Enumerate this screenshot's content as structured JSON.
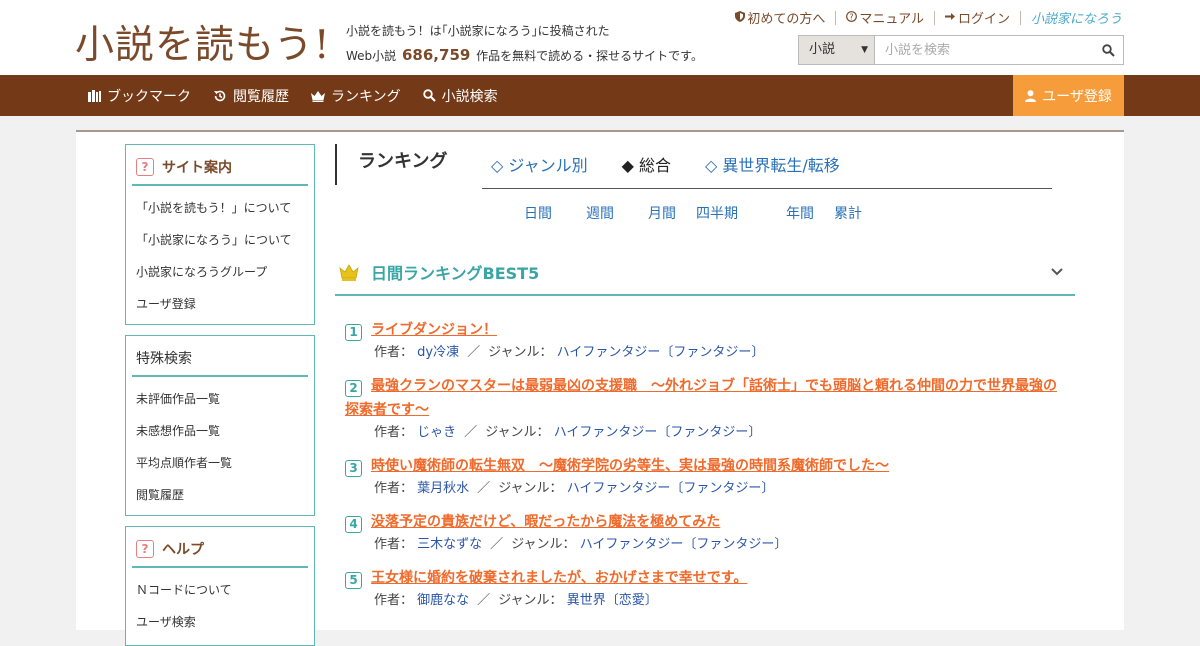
{
  "header": {
    "logo_text": "小説を読もう!",
    "tagline_line1": "小説を読もう！は｢小説家になろう｣に投稿された",
    "tagline_prefix": "Web小説",
    "work_count": "686,759",
    "tagline_suffix": "作品を無料で読める・探せるサイトです。",
    "links": {
      "beginners": "初めての方へ",
      "manual": "マニュアル",
      "login": "ログイン",
      "narou_logo": "小説家になろう"
    },
    "search": {
      "category": "小説",
      "placeholder": "小説を検索"
    }
  },
  "nav": {
    "bookmark": "ブックマーク",
    "history": "閲覧履歴",
    "ranking": "ランキング",
    "search": "小説検索",
    "register": "ユーザ登録"
  },
  "sidebar": {
    "site_guide": {
      "title": "サイト案内",
      "items": [
        "「小説を読もう！」について",
        "「小説家になろう」について",
        "小説家になろうグループ",
        "ユーザ登録"
      ]
    },
    "special_search": {
      "title": "特殊検索",
      "items": [
        "未評価作品一覧",
        "未感想作品一覧",
        "平均点順作者一覧",
        "閲覧履歴"
      ]
    },
    "help": {
      "title": "ヘルプ",
      "items": [
        "Ｎコードについて",
        "ユーザ検索"
      ]
    }
  },
  "ranking": {
    "title": "ランキング",
    "tabs": [
      "◇ ジャンル別",
      "◆ 総合",
      "◇ 異世界転生/転移"
    ],
    "active_tab": 1,
    "periods": [
      "日間",
      "週間",
      "月間",
      "四半期",
      "年間",
      "累計"
    ],
    "section_title": "日間ランキングBEST5",
    "author_label": "作者：",
    "genre_label": "ジャンル：",
    "entries": [
      {
        "rank": "1",
        "title": "ライブダンジョン！",
        "author": "dy冷凍",
        "genre": "ハイファンタジー〔ファンタジー〕"
      },
      {
        "rank": "2",
        "title": "最強クランのマスターは最弱最凶の支援職　～外れジョブ「話術士」でも頭脳と頼れる仲間の力で世界最強の探索者です～",
        "author": "じゃき",
        "genre": "ハイファンタジー〔ファンタジー〕"
      },
      {
        "rank": "3",
        "title": "時使い魔術師の転生無双　～魔術学院の劣等生、実は最強の時間系魔術師でした～",
        "author": "葉月秋水",
        "genre": "ハイファンタジー〔ファンタジー〕"
      },
      {
        "rank": "4",
        "title": "没落予定の貴族だけど、暇だったから魔法を極めてみた",
        "author": "三木なずな",
        "genre": "ハイファンタジー〔ファンタジー〕"
      },
      {
        "rank": "5",
        "title": "王女様に婚約を破棄されましたが、おかげさまで幸せです。",
        "author": "御鹿なな",
        "genre": "異世界〔恋愛〕"
      }
    ]
  }
}
